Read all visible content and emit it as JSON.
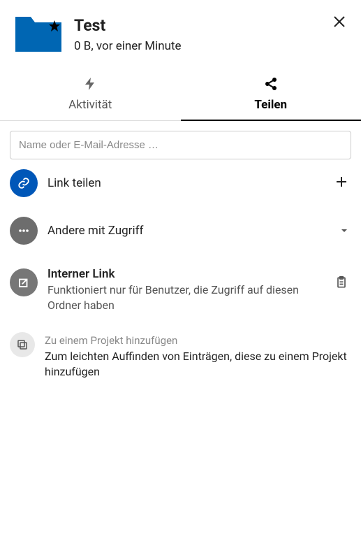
{
  "header": {
    "title": "Test",
    "subtitle": "0 B, vor einer Minute"
  },
  "tabs": {
    "activity": "Aktivität",
    "share": "Teilen"
  },
  "share": {
    "search_placeholder": "Name oder E-Mail-Adresse …",
    "link_share": "Link teilen",
    "others_access": "Andere mit Zugriff",
    "internal_title": "Interner Link",
    "internal_sub": "Funktioniert nur für Benutzer, die Zugriff auf diesen Ordner haben",
    "project_title": "Zu einem Projekt hinzufügen",
    "project_sub": "Zum leichten Auffinden von Einträgen, diese zu einem Projekt hinzufügen"
  }
}
